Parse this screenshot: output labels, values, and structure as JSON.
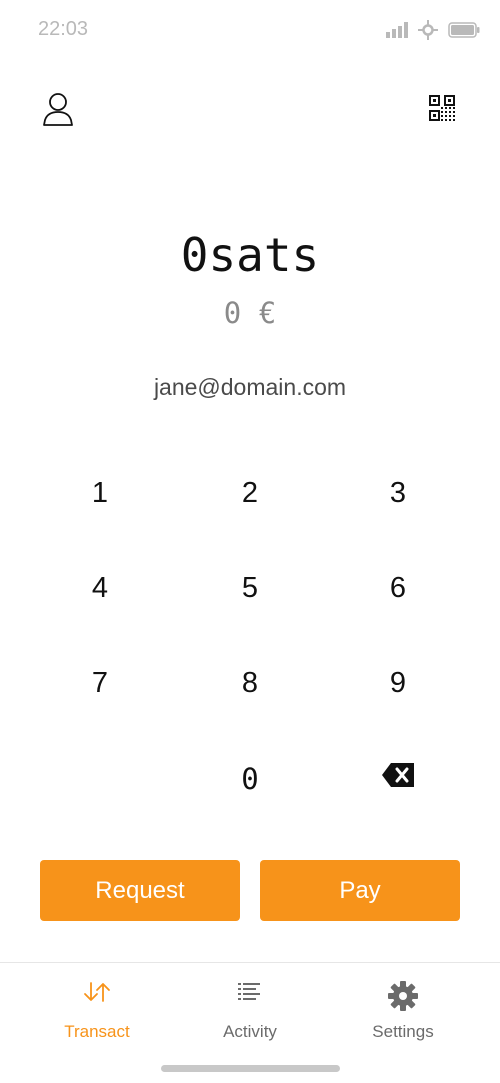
{
  "status_bar": {
    "time": "22:03",
    "icons": [
      "signal-icon",
      "location-icon",
      "battery-icon"
    ]
  },
  "header": {
    "profile_icon": "profile-icon",
    "qr_icon": "qr-code-icon"
  },
  "amount": {
    "sats": "0sats",
    "fiat": "0 €"
  },
  "recipient": "jane@domain.com",
  "keypad": {
    "k1": "1",
    "k2": "2",
    "k3": "3",
    "k4": "4",
    "k5": "5",
    "k6": "6",
    "k7": "7",
    "k8": "8",
    "k9": "9",
    "k0": "0",
    "backspace_icon": "backspace-icon"
  },
  "actions": {
    "request_label": "Request",
    "pay_label": "Pay"
  },
  "nav": {
    "transact": "Transact",
    "activity": "Activity",
    "settings": "Settings",
    "active_tab": "Transact"
  },
  "colors": {
    "accent": "#f7931a",
    "text_primary": "#111111",
    "text_muted": "#8a8a8a"
  }
}
